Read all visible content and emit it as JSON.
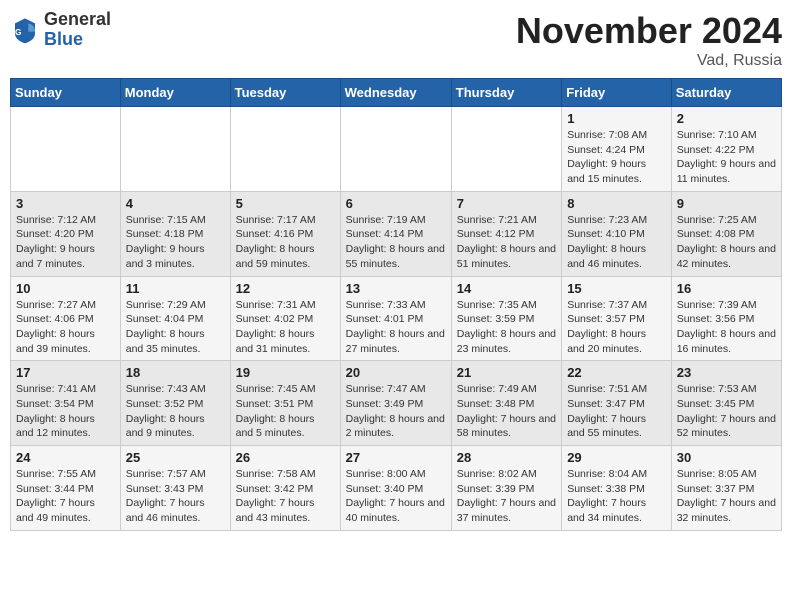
{
  "logo": {
    "general": "General",
    "blue": "Blue"
  },
  "header": {
    "month": "November 2024",
    "location": "Vad, Russia"
  },
  "weekdays": [
    "Sunday",
    "Monday",
    "Tuesday",
    "Wednesday",
    "Thursday",
    "Friday",
    "Saturday"
  ],
  "weeks": [
    [
      {
        "day": "",
        "info": ""
      },
      {
        "day": "",
        "info": ""
      },
      {
        "day": "",
        "info": ""
      },
      {
        "day": "",
        "info": ""
      },
      {
        "day": "",
        "info": ""
      },
      {
        "day": "1",
        "info": "Sunrise: 7:08 AM\nSunset: 4:24 PM\nDaylight: 9 hours and 15 minutes."
      },
      {
        "day": "2",
        "info": "Sunrise: 7:10 AM\nSunset: 4:22 PM\nDaylight: 9 hours and 11 minutes."
      }
    ],
    [
      {
        "day": "3",
        "info": "Sunrise: 7:12 AM\nSunset: 4:20 PM\nDaylight: 9 hours and 7 minutes."
      },
      {
        "day": "4",
        "info": "Sunrise: 7:15 AM\nSunset: 4:18 PM\nDaylight: 9 hours and 3 minutes."
      },
      {
        "day": "5",
        "info": "Sunrise: 7:17 AM\nSunset: 4:16 PM\nDaylight: 8 hours and 59 minutes."
      },
      {
        "day": "6",
        "info": "Sunrise: 7:19 AM\nSunset: 4:14 PM\nDaylight: 8 hours and 55 minutes."
      },
      {
        "day": "7",
        "info": "Sunrise: 7:21 AM\nSunset: 4:12 PM\nDaylight: 8 hours and 51 minutes."
      },
      {
        "day": "8",
        "info": "Sunrise: 7:23 AM\nSunset: 4:10 PM\nDaylight: 8 hours and 46 minutes."
      },
      {
        "day": "9",
        "info": "Sunrise: 7:25 AM\nSunset: 4:08 PM\nDaylight: 8 hours and 42 minutes."
      }
    ],
    [
      {
        "day": "10",
        "info": "Sunrise: 7:27 AM\nSunset: 4:06 PM\nDaylight: 8 hours and 39 minutes."
      },
      {
        "day": "11",
        "info": "Sunrise: 7:29 AM\nSunset: 4:04 PM\nDaylight: 8 hours and 35 minutes."
      },
      {
        "day": "12",
        "info": "Sunrise: 7:31 AM\nSunset: 4:02 PM\nDaylight: 8 hours and 31 minutes."
      },
      {
        "day": "13",
        "info": "Sunrise: 7:33 AM\nSunset: 4:01 PM\nDaylight: 8 hours and 27 minutes."
      },
      {
        "day": "14",
        "info": "Sunrise: 7:35 AM\nSunset: 3:59 PM\nDaylight: 8 hours and 23 minutes."
      },
      {
        "day": "15",
        "info": "Sunrise: 7:37 AM\nSunset: 3:57 PM\nDaylight: 8 hours and 20 minutes."
      },
      {
        "day": "16",
        "info": "Sunrise: 7:39 AM\nSunset: 3:56 PM\nDaylight: 8 hours and 16 minutes."
      }
    ],
    [
      {
        "day": "17",
        "info": "Sunrise: 7:41 AM\nSunset: 3:54 PM\nDaylight: 8 hours and 12 minutes."
      },
      {
        "day": "18",
        "info": "Sunrise: 7:43 AM\nSunset: 3:52 PM\nDaylight: 8 hours and 9 minutes."
      },
      {
        "day": "19",
        "info": "Sunrise: 7:45 AM\nSunset: 3:51 PM\nDaylight: 8 hours and 5 minutes."
      },
      {
        "day": "20",
        "info": "Sunrise: 7:47 AM\nSunset: 3:49 PM\nDaylight: 8 hours and 2 minutes."
      },
      {
        "day": "21",
        "info": "Sunrise: 7:49 AM\nSunset: 3:48 PM\nDaylight: 7 hours and 58 minutes."
      },
      {
        "day": "22",
        "info": "Sunrise: 7:51 AM\nSunset: 3:47 PM\nDaylight: 7 hours and 55 minutes."
      },
      {
        "day": "23",
        "info": "Sunrise: 7:53 AM\nSunset: 3:45 PM\nDaylight: 7 hours and 52 minutes."
      }
    ],
    [
      {
        "day": "24",
        "info": "Sunrise: 7:55 AM\nSunset: 3:44 PM\nDaylight: 7 hours and 49 minutes."
      },
      {
        "day": "25",
        "info": "Sunrise: 7:57 AM\nSunset: 3:43 PM\nDaylight: 7 hours and 46 minutes."
      },
      {
        "day": "26",
        "info": "Sunrise: 7:58 AM\nSunset: 3:42 PM\nDaylight: 7 hours and 43 minutes."
      },
      {
        "day": "27",
        "info": "Sunrise: 8:00 AM\nSunset: 3:40 PM\nDaylight: 7 hours and 40 minutes."
      },
      {
        "day": "28",
        "info": "Sunrise: 8:02 AM\nSunset: 3:39 PM\nDaylight: 7 hours and 37 minutes."
      },
      {
        "day": "29",
        "info": "Sunrise: 8:04 AM\nSunset: 3:38 PM\nDaylight: 7 hours and 34 minutes."
      },
      {
        "day": "30",
        "info": "Sunrise: 8:05 AM\nSunset: 3:37 PM\nDaylight: 7 hours and 32 minutes."
      }
    ]
  ]
}
